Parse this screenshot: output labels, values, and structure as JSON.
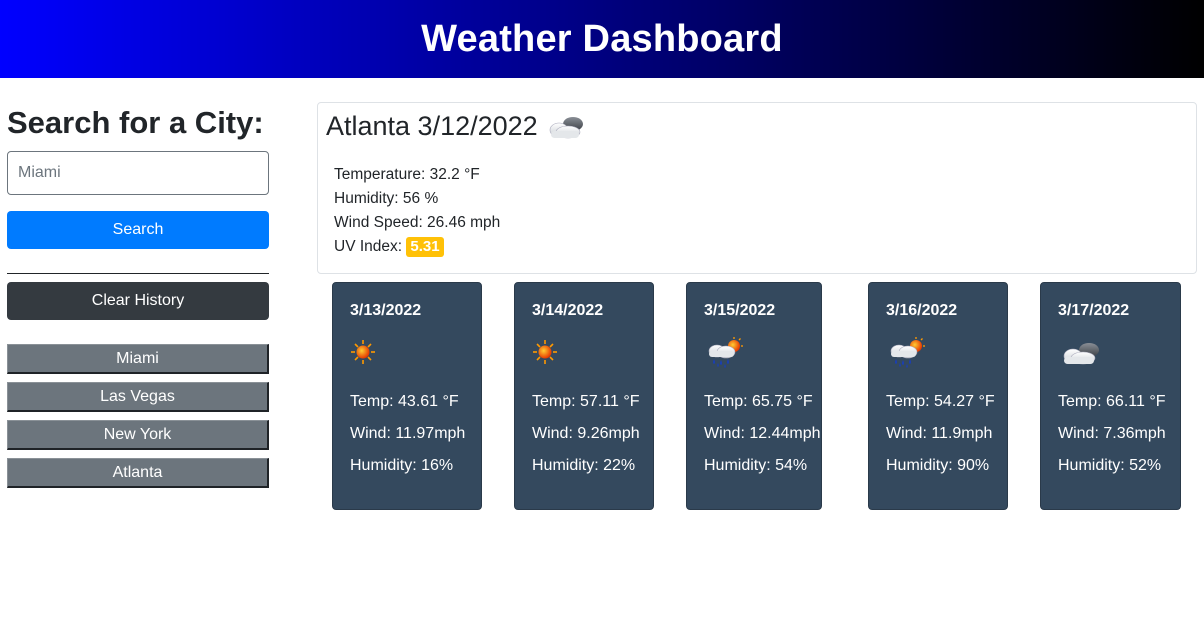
{
  "header": {
    "title": "Weather Dashboard"
  },
  "sidebar": {
    "heading": "Search for a City:",
    "search_placeholder": "Miami",
    "search_button": "Search",
    "clear_button": "Clear History",
    "history": [
      {
        "label": "Miami"
      },
      {
        "label": "Las Vegas"
      },
      {
        "label": "New York"
      },
      {
        "label": "Atlanta"
      }
    ]
  },
  "current": {
    "title": "Atlanta 3/12/2022",
    "icon": "cloudy-icon",
    "temperature": "Temperature: 32.2 °F",
    "humidity": "Humidity: 56 %",
    "wind": "Wind Speed: 26.46 mph",
    "uv_label": "UV Index:",
    "uv_value": "5.31",
    "uv_color": "#ffc107"
  },
  "forecast": [
    {
      "date": "3/13/2022",
      "icon": "sun-icon",
      "temp": "Temp: 43.61 °F",
      "wind": "Wind: 11.97mph",
      "humidity": "Humidity: 16%"
    },
    {
      "date": "3/14/2022",
      "icon": "sun-icon",
      "temp": "Temp: 57.11 °F",
      "wind": "Wind: 9.26mph",
      "humidity": "Humidity: 22%"
    },
    {
      "date": "3/15/2022",
      "icon": "rain-sun-icon",
      "temp": "Temp: 65.75 °F",
      "wind": "Wind: 12.44mph",
      "humidity": "Humidity: 54%"
    },
    {
      "date": "3/16/2022",
      "icon": "rain-sun-icon",
      "temp": "Temp: 54.27 °F",
      "wind": "Wind: 11.9mph",
      "humidity": "Humidity: 90%"
    },
    {
      "date": "3/17/2022",
      "icon": "cloudy-icon",
      "temp": "Temp: 66.11 °F",
      "wind": "Wind: 7.36mph",
      "humidity": "Humidity: 52%"
    }
  ],
  "colors": {
    "header_start": "#0000ff",
    "header_end": "#000000",
    "primary": "#007bff",
    "card": "#34495e"
  }
}
